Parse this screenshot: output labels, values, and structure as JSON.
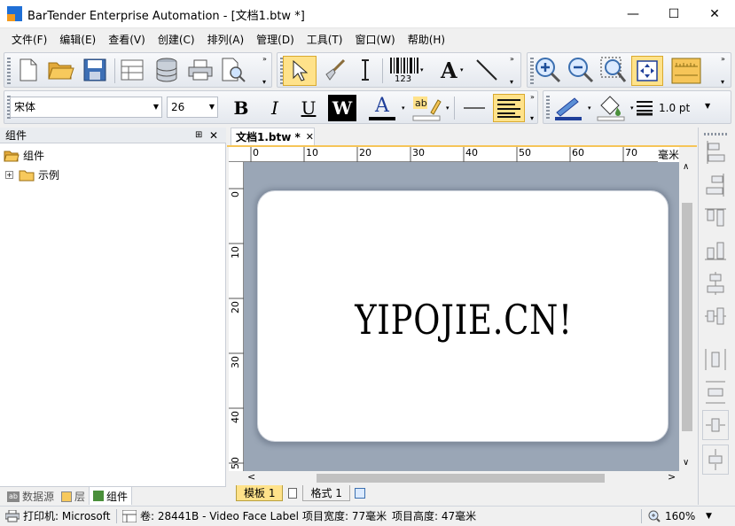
{
  "window": {
    "title": "BarTender Enterprise Automation - [文档1.btw *]",
    "minimize": "—",
    "maximize": "☐",
    "close": "✕"
  },
  "menu": [
    "文件(F)",
    "编辑(E)",
    "查看(V)",
    "创建(C)",
    "排列(A)",
    "管理(D)",
    "工具(T)",
    "窗口(W)",
    "帮助(H)"
  ],
  "format": {
    "font": "宋体",
    "size": "26",
    "bold": "B",
    "italic": "I",
    "underline": "U",
    "wrap": "W",
    "textcolor": "A",
    "linewidth": "1.0 pt"
  },
  "barcode_label": "123",
  "panel": {
    "title": "组件",
    "pin": "📌",
    "close": "✕",
    "tree": [
      {
        "label": "组件"
      },
      {
        "label": "示例"
      }
    ],
    "tabs": [
      "数据源",
      "层",
      "组件"
    ]
  },
  "doc_tab": {
    "label": "文档1.btw *",
    "close": "✕"
  },
  "ruler": {
    "h_ticks": [
      "0",
      "10",
      "20",
      "30",
      "40",
      "50",
      "60",
      "70"
    ],
    "unit": "毫米",
    "v_ticks": [
      "0",
      "10",
      "20",
      "30",
      "40",
      "50"
    ]
  },
  "label_text": "YIPOJIE.CN!",
  "bottom_tabs": [
    "模板 1",
    "格式 1"
  ],
  "status": {
    "printer": "打印机: Microsoft",
    "stock": "卷: 28441B - Video Face Label",
    "width": "项目宽度: 77毫米",
    "height": "项目高度: 47毫米",
    "zoom": "160%"
  },
  "colors": {
    "accent": "#1f6fd6",
    "highlight": "#ffe28a",
    "canvas_bg": "#9aa6b6"
  }
}
